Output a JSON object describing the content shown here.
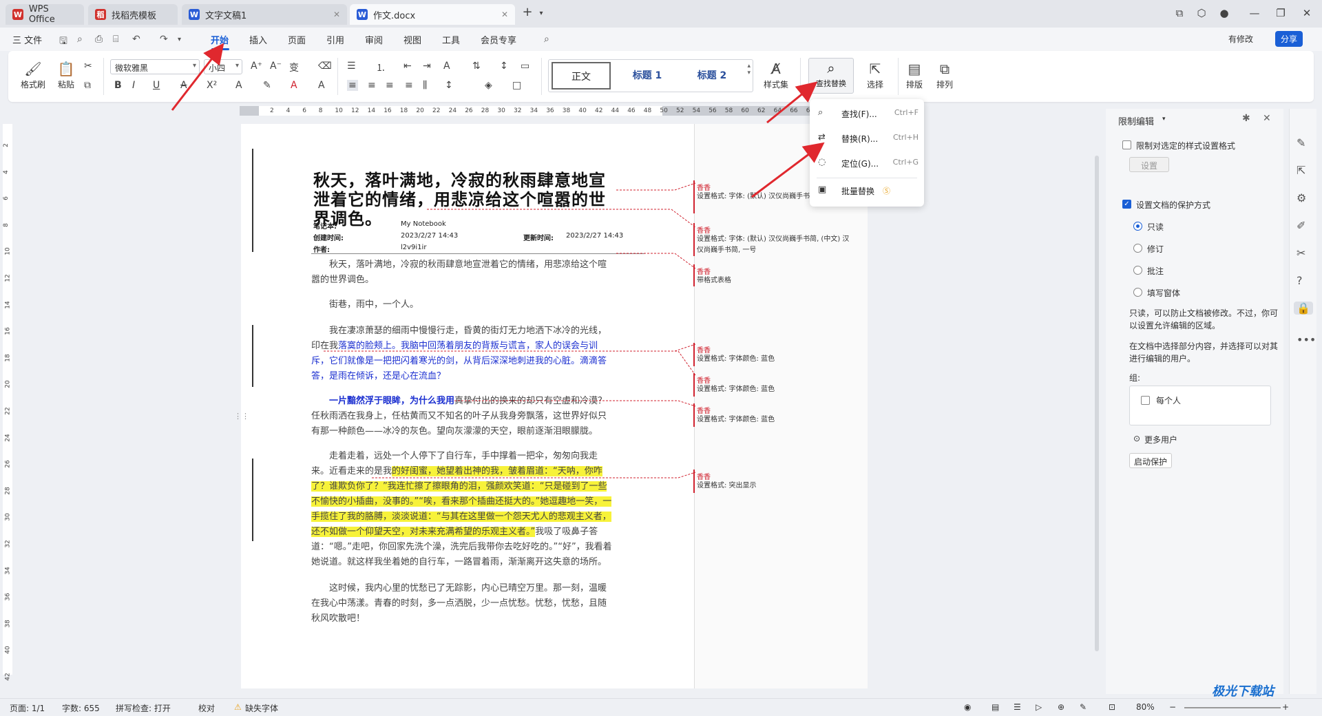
{
  "tabs": [
    {
      "label": "WPS Office",
      "logo": "W",
      "logo_color": "#d0312d"
    },
    {
      "label": "找稻壳模板",
      "logo": "稻",
      "logo_color": "#d0312d"
    },
    {
      "label": "文字文稿1",
      "logo": "W",
      "logo_color": "#2a5cd6"
    },
    {
      "label": "作文.docx",
      "logo": "W",
      "logo_color": "#2a5cd6"
    }
  ],
  "menu": {
    "file": "三 文件",
    "items": [
      "开始",
      "插入",
      "页面",
      "引用",
      "审阅",
      "视图",
      "工具",
      "会员专享"
    ],
    "active": "开始",
    "has_changes": "有修改",
    "share": "分享"
  },
  "ribbon": {
    "format_painter": "格式刷",
    "paste": "粘贴",
    "font_name": "微软雅黑",
    "font_size": "小四",
    "styles": [
      "正文",
      "标题 1",
      "标题 2"
    ],
    "style_set": "样式集",
    "find_replace": "查找替换",
    "select": "选择",
    "layout": "排版",
    "arrange": "排列"
  },
  "dropdown": [
    {
      "label": "查找(F)...",
      "shortcut": "Ctrl+F",
      "icon": "search-icon"
    },
    {
      "label": "替换(R)...",
      "shortcut": "Ctrl+H",
      "icon": "replace-icon"
    },
    {
      "label": "定位(G)...",
      "shortcut": "Ctrl+G",
      "icon": "goto-icon"
    },
    {
      "label": "批量替换",
      "shortcut": "",
      "icon": "batch-replace-icon"
    }
  ],
  "ruler_h": [
    "2",
    "4",
    "6",
    "8",
    "10",
    "12",
    "14",
    "16",
    "18",
    "20",
    "22",
    "24",
    "26",
    "28",
    "30",
    "32",
    "34",
    "36",
    "38",
    "40",
    "42",
    "44",
    "46",
    "48",
    "50",
    "52",
    "54",
    "56",
    "58",
    "60",
    "62",
    "64",
    "66",
    "68"
  ],
  "ruler_v": [
    "2",
    "4",
    "6",
    "8",
    "10",
    "12",
    "14",
    "16",
    "18",
    "20",
    "22",
    "24",
    "26",
    "28",
    "30",
    "32",
    "34",
    "36",
    "38",
    "40",
    "42"
  ],
  "document": {
    "title": "秋天，落叶满地，冷寂的秋雨肆意地宣泄着它的情绪，用悲凉给这个喧嚣的世界调色。",
    "meta": {
      "notebook_label": "笔记本:",
      "notebook_value": "My Notebook",
      "created_label": "创建时间:",
      "created_value": "2023/2/27 14:43",
      "updated_label": "更新时间:",
      "updated_value": "2023/2/27 14:43",
      "author_label": "作者:",
      "author_value": "l2v9i1ir"
    },
    "p1": "秋天，落叶满地，冷寂的秋雨肆意地宣泄着它的情绪，用悲凉给这个喧嚣的世界调色。",
    "p2": "街巷，雨中，一个人。",
    "p3a": "我在凄凉萧瑟的细雨中慢慢行走，昏黄的街灯无力地洒下冰冷的光线，印在我",
    "p3b": "落寞的脸颊上。我脑中回荡着朋友的背叛与谎言，家人的误会与训斥，它们就像是一把把闪着寒光的剑，从背后深深地刺进我的心脏。滴滴答答，是雨在倾诉，还是心在流血？",
    "p4a": "一片黯然浮于眼眸，为什么我用",
    "p4b": "真挚付出的换来的却只有空虚和冷漠？任秋雨洒在我身上，任枯黄而又不知名的叶子从我身旁飘落，这世界好似只有那一种颜色——冰冷的灰色。望向灰濛濛的天空，眼前逐渐泪眼朦胧。",
    "p5a": "走着走着，远处一个人停下了自行车，手中撑着一把伞，匆匆向我走来。近看走来的是我",
    "p5b": "的好闺蜜，她望着出神的我，皱着眉道：“天呐，你咋了？谁欺负你了？”我连忙擦了擦眼角的泪，强颜欢笑道：“只是碰到了一些不愉快的小插曲，没事的。”“唉，看来那个插曲还挺大的。”她逗趣地一笑，一手揽住了我的胳膊，淡淡说道：“与其在这里做一个怨天尤人的悲观主义者，还不如做一个仰望天空，对未来充满希望的乐观主义者。”",
    "p5c": "我吸了吸鼻子答道：“嗯。”走吧，你回家先洗个澡，洗完后我带你去吃好吃的。”“好”，我看着她说道。就这样我坐着她的自行车，一路冒着雨，渐渐离开这失意的场所。",
    "p6": "这时候，我内心里的忧愁已了无踪影，内心已晴空万里。那一刻，温暖在我心中荡漾。青春的时刻，多一点洒脱，少一点忧愁。忧愁，忧愁，且随秋风吹散吧！"
  },
  "comments": [
    {
      "author": "香香",
      "text": "设置格式: 字体: (默认) 汉仪尚巍手书简, 一号"
    },
    {
      "author": "香香",
      "text": "设置格式: 字体: (默认) 汉仪尚巍手书简, (中文) 汉仪尚巍手书简, 一号"
    },
    {
      "author": "香香",
      "text": "带格式表格"
    },
    {
      "author": "香香",
      "text": "设置格式: 字体颜色: 蓝色"
    },
    {
      "author": "香香",
      "text": "设置格式: 字体颜色: 蓝色"
    },
    {
      "author": "香香",
      "text": "设置格式: 字体颜色: 蓝色"
    },
    {
      "author": "香香",
      "text": "设置格式: 突出显示"
    }
  ],
  "panel": {
    "title": "限制编辑",
    "limit_format": "限制对选定的样式设置格式",
    "settings_btn": "设置",
    "protect_label": "设置文档的保护方式",
    "options": [
      "只读",
      "修订",
      "批注",
      "填写窗体"
    ],
    "selected": "只读",
    "desc1": "只读，可以防止文档被修改。不过，你可以设置允许编辑的区域。",
    "desc2": "在文档中选择部分内容，并选择可以对其进行编辑的用户。",
    "group_label": "组:",
    "everyone": "每个人",
    "more_users": "更多用户",
    "start_btn": "启动保护"
  },
  "status": {
    "page": "页面: 1/1",
    "words": "字数: 655",
    "spell": "拼写检查: 打开",
    "proof": "校对",
    "missing_font": "缺失字体",
    "zoom": "80%",
    "watermark": "极光下载站"
  },
  "colors": {
    "accent": "#1a5fd6",
    "arrow": "#e0282e",
    "highlight": "#f7f23a",
    "revision_blue": "#1b2fd0"
  }
}
